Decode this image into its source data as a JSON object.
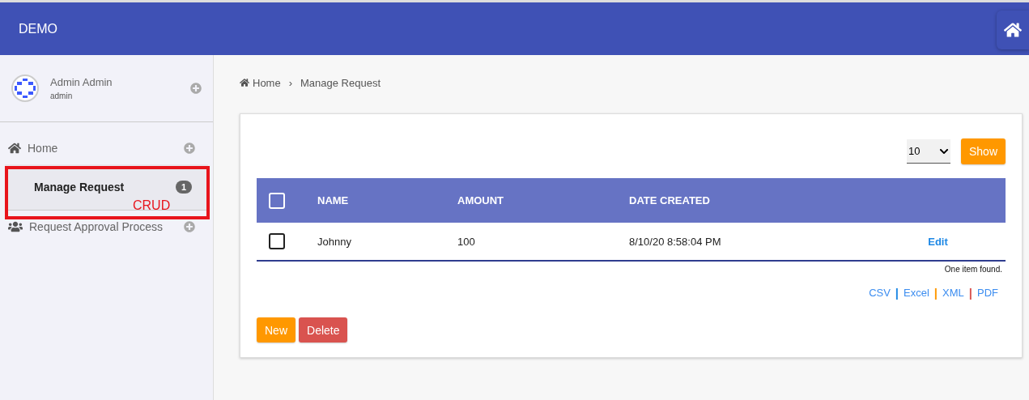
{
  "header": {
    "title": "DEMO"
  },
  "user": {
    "name": "Admin Admin",
    "role": "admin"
  },
  "sidebar": {
    "items": [
      {
        "label": "Home",
        "kind": "section",
        "selected": false
      },
      {
        "label": "Manage Request",
        "kind": "subitem",
        "selected": true,
        "badge": "1"
      },
      {
        "label": "Request Approval Process",
        "kind": "group",
        "selected": false
      }
    ]
  },
  "annotation": {
    "label": "CRUD"
  },
  "breadcrumb": {
    "items": [
      "Home",
      "Manage Request"
    ],
    "separator": "›"
  },
  "page_size": {
    "value": "10"
  },
  "show_button": "Show",
  "table": {
    "columns": [
      "NAME",
      "AMOUNT",
      "DATE CREATED"
    ],
    "header_checked": false,
    "rows": [
      {
        "checked": false,
        "cells": [
          "Johnny",
          "100",
          "8/10/20 8:58:04 PM"
        ],
        "action": "Edit"
      }
    ]
  },
  "summary": "One item found.",
  "exports": [
    {
      "label": "CSV",
      "separator": "|",
      "color": "#1e88e5"
    },
    {
      "label": "Excel",
      "separator": "|",
      "color": "#ff9800"
    },
    {
      "label": "XML",
      "separator": "|",
      "color": "#d9534f"
    },
    {
      "label": "PDF"
    }
  ],
  "buttons": [
    {
      "label": "New",
      "kind": "primary"
    },
    {
      "label": "Delete",
      "kind": "danger"
    }
  ]
}
